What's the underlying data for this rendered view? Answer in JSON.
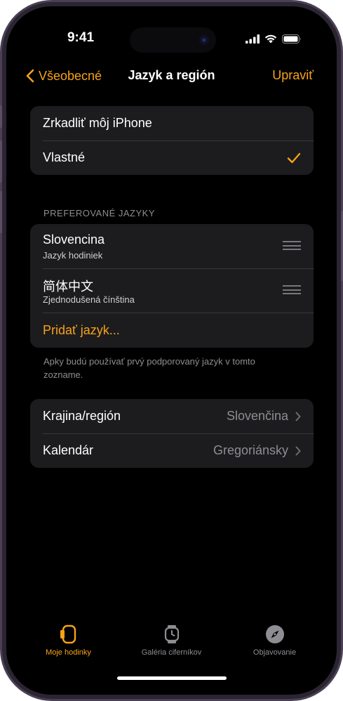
{
  "status_bar": {
    "time": "9:41"
  },
  "nav": {
    "back_label": "Všeobecné",
    "title": "Jazyk a región",
    "edit_label": "Upraviť"
  },
  "mode_group": {
    "mirror_label": "Zrkadliť môj iPhone",
    "custom_label": "Vlastné",
    "selected": "Vlastné"
  },
  "languages": {
    "header": "PREFEROVANÉ JAZYKY",
    "items": [
      {
        "name": "Slovencina",
        "subtitle": "Jazyk hodiniek"
      },
      {
        "name": "简体中文",
        "subtitle": "Zjednodušená čínština"
      }
    ],
    "add_label": "Pridať jazyk...",
    "footnote": "Apky budú používať prvý podporovaný jazyk v tomto zozname."
  },
  "region_group": {
    "region_label": "Krajina/región",
    "region_value": "Slovenčina",
    "calendar_label": "Kalendár",
    "calendar_value": "Gregoriánsky"
  },
  "tabbar": {
    "tabs": [
      {
        "label": "Moje hodinky",
        "icon": "watch-face-icon",
        "active": true
      },
      {
        "label": "Galéria ciferníkov",
        "icon": "watch-icon",
        "active": false
      },
      {
        "label": "Objavovanie",
        "icon": "compass-icon",
        "active": false
      }
    ]
  },
  "colors": {
    "accent": "#f7a218",
    "background": "#000000",
    "group": "#1c1c1e",
    "secondary_text": "#8d8d93"
  }
}
